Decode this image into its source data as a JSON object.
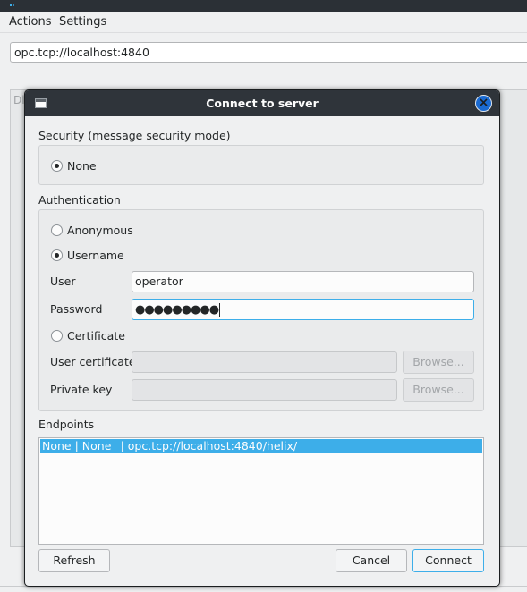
{
  "menubar": {
    "items": [
      "Actions",
      "Settings"
    ]
  },
  "address": {
    "value": "opc.tcp://localhost:4840"
  },
  "background": {
    "fragment": "Di"
  },
  "dialog": {
    "title": "Connect to server",
    "security": {
      "label": "Security (message security mode)",
      "options": [
        {
          "label": "None",
          "selected": true
        }
      ]
    },
    "authentication": {
      "label": "Authentication",
      "anonymous_label": "Anonymous",
      "username_label": "Username",
      "selected": "Username",
      "user_label": "User",
      "user_value": "operator",
      "password_label": "Password",
      "password_mask": "●●●●●●●●●",
      "certificate_label": "Certificate",
      "user_certificate_label": "User certificate",
      "private_key_label": "Private key",
      "browse_label": "Browse..."
    },
    "endpoints": {
      "label": "Endpoints",
      "items": [
        "None | None_ | opc.tcp://localhost:4840/helix/"
      ],
      "selected_index": 0
    },
    "buttons": {
      "refresh": "Refresh",
      "cancel": "Cancel",
      "connect": "Connect"
    }
  },
  "colors": {
    "accent": "#3daee9",
    "titlebar": "#2f343a",
    "close_button": "#1a6ad1",
    "window_background": "#eff0f1"
  }
}
